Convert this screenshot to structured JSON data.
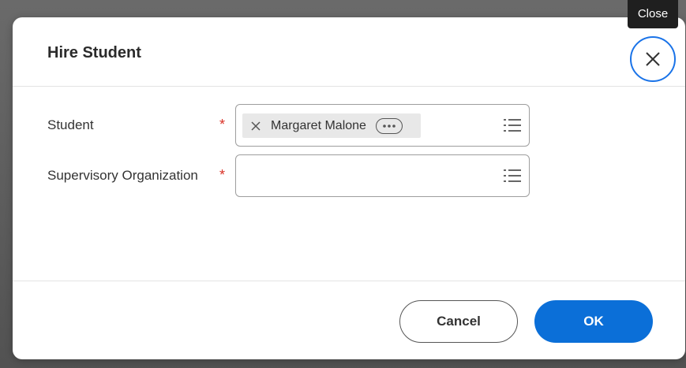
{
  "tooltip": {
    "text": "Close"
  },
  "dialog": {
    "title": "Hire Student",
    "close_icon": "close-icon"
  },
  "form": {
    "student": {
      "label": "Student",
      "required_mark": "*",
      "selected_value": "Margaret Malone",
      "remove_icon": "x-icon",
      "more_icon": "ellipsis-icon",
      "list_icon": "list-icon"
    },
    "supervisory_org": {
      "label": "Supervisory Organization",
      "required_mark": "*",
      "value": "",
      "list_icon": "list-icon"
    }
  },
  "footer": {
    "cancel_label": "Cancel",
    "ok_label": "OK"
  },
  "colors": {
    "accent": "#0b6fd8",
    "close_ring": "#1a73e8",
    "required": "#d93025"
  }
}
